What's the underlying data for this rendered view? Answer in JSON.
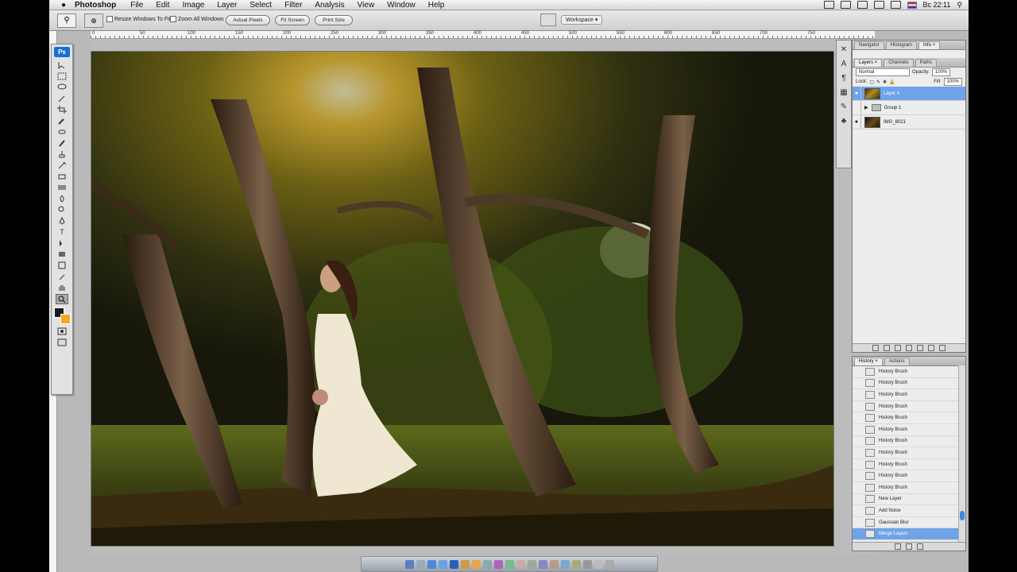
{
  "menubar": {
    "app_name": "Photoshop",
    "items": [
      "File",
      "Edit",
      "Image",
      "Layer",
      "Select",
      "Filter",
      "Analysis",
      "View",
      "Window",
      "Help"
    ],
    "clock": "Вс 22:11"
  },
  "options_bar": {
    "resize_windows_label": "Resize Windows To Fit",
    "zoom_all_label": "Zoom All Windows",
    "actual_pixels_label": "Actual Pixels",
    "fit_screen_label": "Fit Screen",
    "print_size_label": "Print Size",
    "workspace_label": "Workspace ▾"
  },
  "ruler": {
    "labels": [
      "0",
      "50",
      "100",
      "150",
      "200",
      "250",
      "300",
      "350",
      "400",
      "450",
      "500",
      "550",
      "600",
      "650",
      "700",
      "750"
    ]
  },
  "tools": {
    "logo": "Ps",
    "colors": {
      "foreground": "#1a1a1a",
      "background": "#f5a623"
    }
  },
  "layers_panel": {
    "top_tabs": [
      "Navigator",
      "Histogram",
      "Info ×"
    ],
    "tabs": [
      "Layers ×",
      "Channels",
      "Paths"
    ],
    "blend_mode": "Normal",
    "opacity_label": "Opacity:",
    "opacity_value": "100%",
    "lock_label": "Lock:",
    "fill_label": "Fill:",
    "fill_value": "100%",
    "layers": [
      {
        "name": "Layer 4",
        "selected": true
      },
      {
        "name": "Group 1",
        "selected": false
      },
      {
        "name": "IMG_8021",
        "selected": false
      }
    ]
  },
  "history_panel": {
    "tabs": [
      "History ×",
      "Actions"
    ],
    "items": [
      "History Brush",
      "History Brush",
      "History Brush",
      "History Brush",
      "History Brush",
      "History Brush",
      "History Brush",
      "History Brush",
      "History Brush",
      "History Brush",
      "History Brush",
      "New Layer",
      "Add Noise",
      "Gaussian Blur",
      "Merge Layers"
    ],
    "selected_index": 14
  }
}
